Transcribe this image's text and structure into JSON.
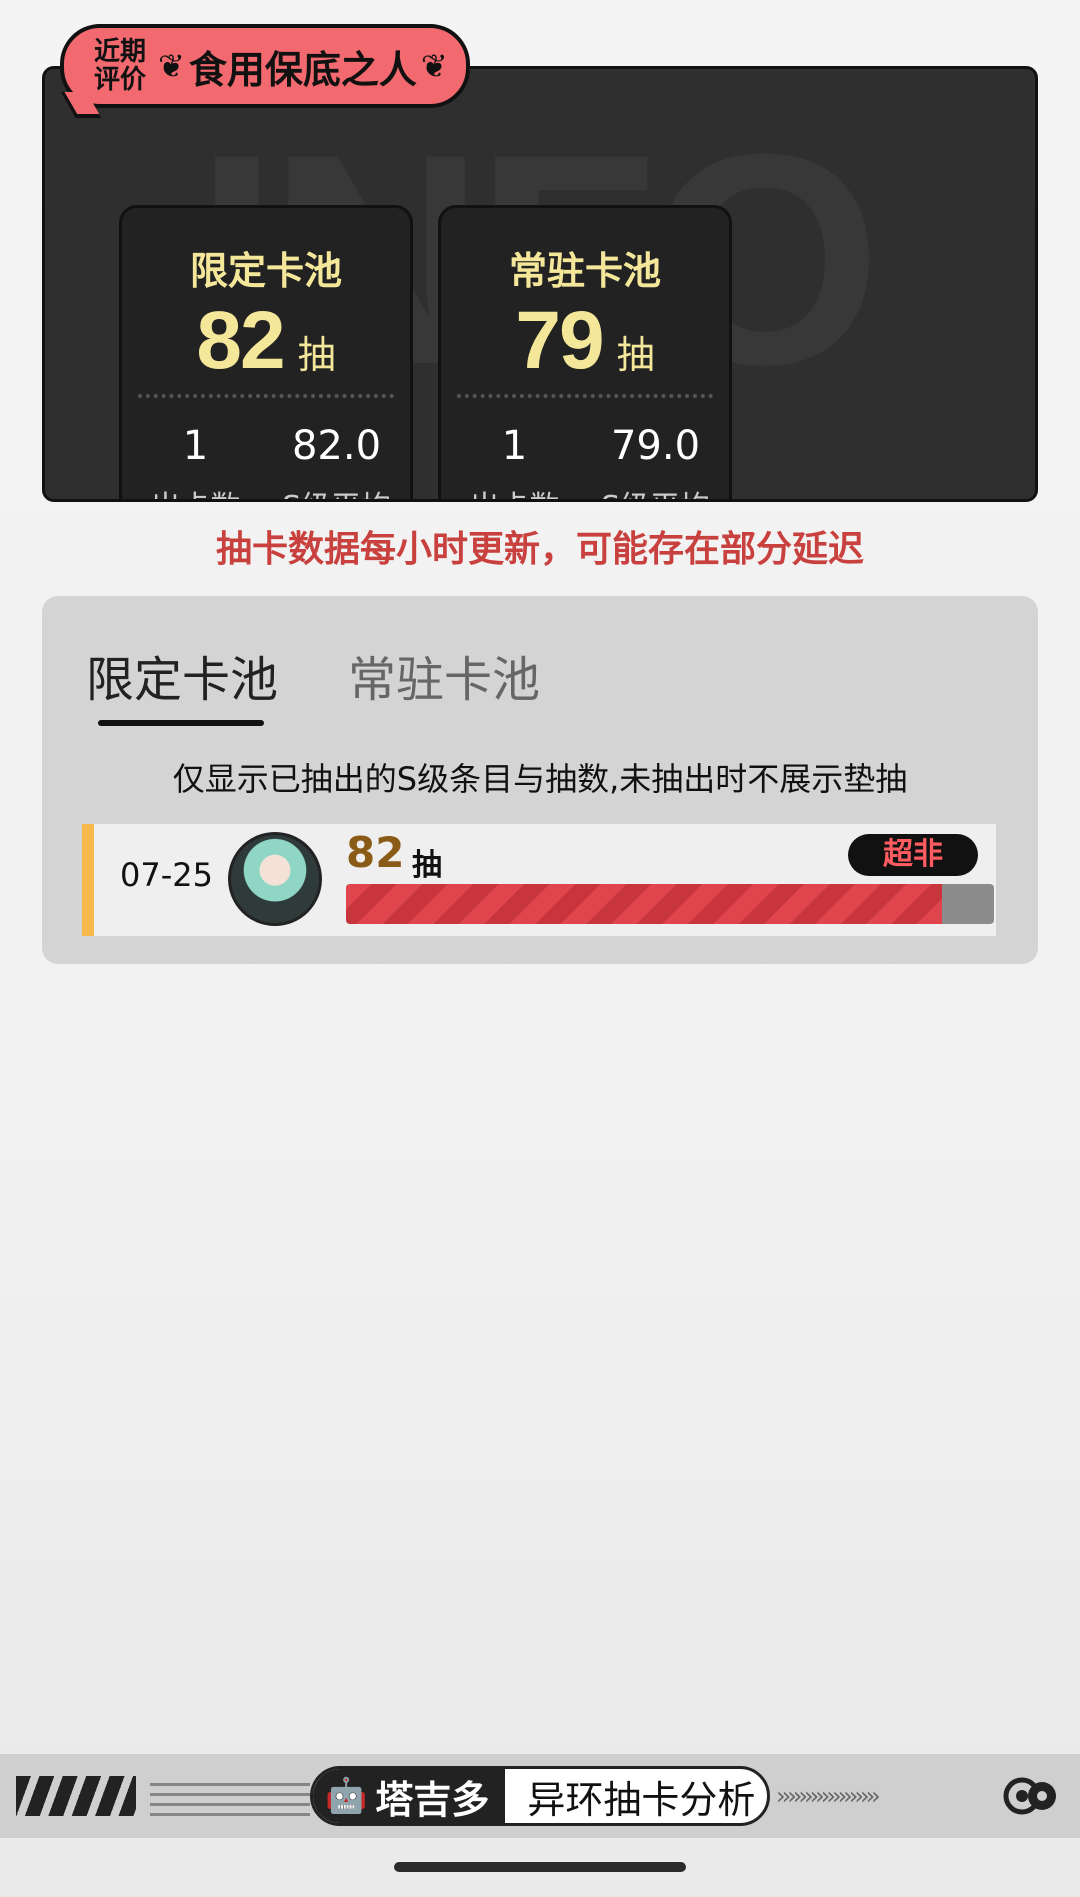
{
  "rating": {
    "label": "近期评价",
    "title": "食用保底之人"
  },
  "pools": [
    {
      "name": "限定卡池",
      "pulls": "82",
      "unit": "抽",
      "count_value": "1",
      "count_label": "出卡数",
      "avg_value": "82.0",
      "avg_label": "S级平均"
    },
    {
      "name": "常驻卡池",
      "pulls": "79",
      "unit": "抽",
      "count_value": "1",
      "count_label": "出卡数",
      "avg_value": "79.0",
      "avg_label": "S级平均"
    }
  ],
  "notice": "抽卡数据每小时更新，可能存在部分延迟",
  "history": {
    "tabs": [
      "限定卡池",
      "常驻卡池"
    ],
    "active_tab": 0,
    "note": "仅显示已抽出的S级条目与抽数,未抽出时不展示垫抽",
    "records": [
      {
        "date": "07-25",
        "pulls": "82",
        "unit": "抽",
        "badge": "超非",
        "progress": 0.92
      }
    ]
  },
  "footer": {
    "brand": "塔吉多",
    "subtitle": "异环抽卡分析"
  },
  "colors": {
    "accent_yellow": "#f5e79a",
    "tag_red": "#f26a6f",
    "notice_red": "#c9413e",
    "bar_red": "#e0454d",
    "record_stripe": "#f5b94a"
  }
}
